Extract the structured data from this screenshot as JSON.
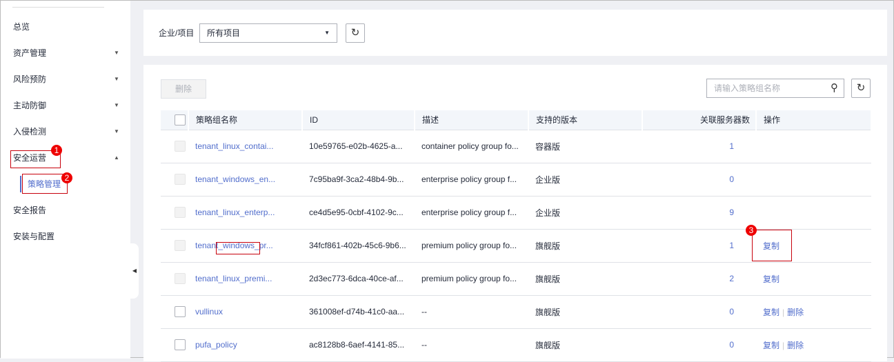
{
  "sidebar": {
    "items": [
      {
        "label": "总览",
        "arrow": ""
      },
      {
        "label": "资产管理",
        "arrow": "▼"
      },
      {
        "label": "风险预防",
        "arrow": "▼"
      },
      {
        "label": "主动防御",
        "arrow": "▼"
      },
      {
        "label": "入侵检测",
        "arrow": "▼"
      },
      {
        "label": "安全运营",
        "arrow": "▲"
      }
    ],
    "sub_item": "策略管理",
    "bottom_items": [
      "安全报告",
      "安装与配置"
    ]
  },
  "annotations": [
    "1",
    "2",
    "3"
  ],
  "filter": {
    "label": "企业/项目",
    "value": "所有项目"
  },
  "toolbar": {
    "delete": "删除",
    "search_placeholder": "请输入策略组名称"
  },
  "table": {
    "headers": [
      "策略组名称",
      "ID",
      "描述",
      "支持的版本",
      "关联服务器数",
      "操作"
    ],
    "rows": [
      {
        "name": "tenant_linux_contai...",
        "id": "10e59765-e02b-4625-a...",
        "desc": "container policy group fo...",
        "version": "容器版",
        "servers": "1",
        "ops": [],
        "disabled": true
      },
      {
        "name": "tenant_windows_en...",
        "id": "7c95ba9f-3ca2-48b4-9b...",
        "desc": "enterprise policy group f...",
        "version": "企业版",
        "servers": "0",
        "ops": [],
        "disabled": true
      },
      {
        "name": "tenant_linux_enterp...",
        "id": "ce4d5e95-0cbf-4102-9c...",
        "desc": "enterprise policy group f...",
        "version": "企业版",
        "servers": "9",
        "ops": [],
        "disabled": true
      },
      {
        "name": "tenant_windows_pr...",
        "id": "34fcf861-402b-45c6-9b6...",
        "desc": "premium policy group fo...",
        "version": "旗舰版",
        "servers": "1",
        "ops": [
          "复制"
        ],
        "disabled": true
      },
      {
        "name": "tenant_linux_premi...",
        "id": "2d3ec773-6dca-40ce-af...",
        "desc": "premium policy group fo...",
        "version": "旗舰版",
        "servers": "2",
        "ops": [
          "复制"
        ],
        "disabled": true
      },
      {
        "name": "vullinux",
        "id": "361008ef-d74b-41c0-aa...",
        "desc": "--",
        "version": "旗舰版",
        "servers": "0",
        "ops": [
          "复制",
          "删除"
        ],
        "disabled": false
      },
      {
        "name": "pufa_policy",
        "id": "ac8128b8-6aef-4141-85...",
        "desc": "--",
        "version": "旗舰版",
        "servers": "0",
        "ops": [
          "复制",
          "删除"
        ],
        "disabled": false
      }
    ]
  }
}
